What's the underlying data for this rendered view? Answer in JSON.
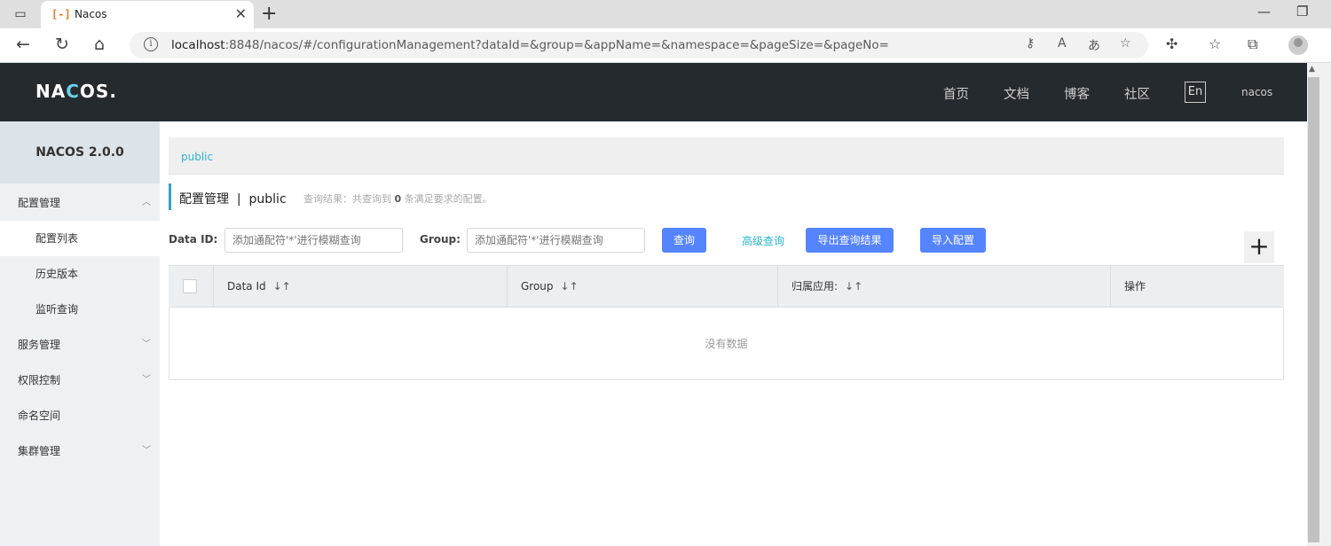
{
  "browser": {
    "tab_title": "Nacos",
    "tab_favicon": "[-]",
    "url_host": "localhost",
    "url_rest": ":8848/nacos/#/configurationManagement?dataId=&group=&appName=&namespace=&pageSize=&pageNo=",
    "icons": [
      "sidebar-toggle-icon",
      "nacos-favicon",
      "close-tab-icon",
      "new-tab-icon",
      "minimize-icon",
      "restore-icon",
      "back-icon",
      "reload-icon",
      "home-icon",
      "info-icon",
      "key-icon",
      "read-aloud-icon",
      "translate-icon",
      "favorite-add-icon",
      "extensions-icon",
      "favorites-icon",
      "collections-icon",
      "profile-avatar"
    ]
  },
  "header": {
    "logo": "NACOS.",
    "nav": [
      "首页",
      "文档",
      "博客",
      "社区"
    ],
    "lang": "En",
    "user": "nacos"
  },
  "sidebar": {
    "version": "NACOS 2.0.0",
    "items": [
      {
        "label": "配置管理",
        "expanded": true
      },
      {
        "label": "配置列表"
      },
      {
        "label": "历史版本"
      },
      {
        "label": "监听查询"
      },
      {
        "label": "服务管理",
        "expanded": false
      },
      {
        "label": "权限控制",
        "expanded": false
      },
      {
        "label": "命名空间"
      },
      {
        "label": "集群管理",
        "expanded": false
      }
    ]
  },
  "namespace_bar": {
    "current": "public"
  },
  "page": {
    "title": "配置管理  |  public",
    "result_prefix": "查询结果：共查询到 ",
    "result_count": "0",
    "result_suffix": " 条满足要求的配置。"
  },
  "filters": {
    "data_id_label": "Data ID:",
    "data_id_placeholder": "添加通配符'*'进行模糊查询",
    "group_label": "Group:",
    "group_placeholder": "添加通配符'*'进行模糊查询",
    "query_btn": "查询",
    "advanced_link": "高级查询",
    "export_btn": "导出查询结果",
    "import_btn": "导入配置",
    "add_btn": "+"
  },
  "table": {
    "columns": [
      "Data Id",
      "Group",
      "归属应用:",
      "操作"
    ],
    "sort_glyph": "↓↑",
    "empty_text": "没有数据"
  },
  "colors": {
    "primary": "#5584ff",
    "link": "#28b4ce",
    "header_bg": "#252a2f"
  }
}
